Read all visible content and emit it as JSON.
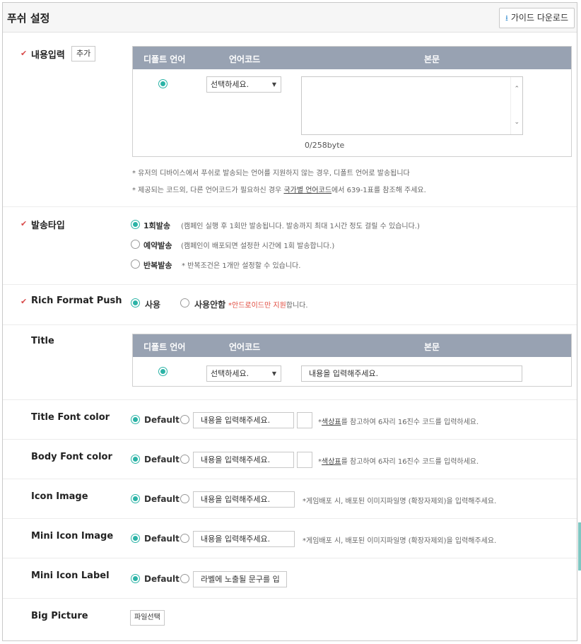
{
  "header": {
    "title": "푸쉬 설정",
    "guide_button": "가이드 다운로드"
  },
  "content_input": {
    "label": "내용입력",
    "add_button": "추가",
    "table_headers": [
      "디폴트 언어",
      "언어코드",
      "본문"
    ],
    "select_value": "선택하세요.",
    "byte_count": "0/258byte",
    "note1": "* 유저의 디바이스에서 푸쉬로 발송되는 언어를 지원하지 않는 경우, 디폴트 언어로 발송됩니다",
    "note2_prefix": "* 제공되는 코드외, 다른 언어코드가 필요하신 경우 ",
    "note2_link": "국가별 언어코드",
    "note2_suffix": "에서 639-1표를 참조해 주세요."
  },
  "send_type": {
    "label": "발송타입",
    "options": [
      {
        "label": "1회발송",
        "desc": "(캠페인 실행 후 1회만 발송됩니다. 발송까지 최대 1시간 정도 걸릴 수 있습니다.)",
        "selected": true
      },
      {
        "label": "예약발송",
        "desc": "(캠페인이 배포되면 설정한 시간에 1회 발송합니다.)",
        "selected": false
      },
      {
        "label": "반복발송",
        "desc": "* 반복조건은 1개만 설정할 수 있습니다.",
        "selected": false
      }
    ]
  },
  "rich_format": {
    "label": "Rich Format Push",
    "use": "사용",
    "not_use": "사용안함",
    "note_prefix": "*",
    "note_red": "안드로이드만 지원",
    "note_suffix": "합니다."
  },
  "title_row": {
    "label": "Title",
    "table_headers": [
      "디폴트 언어",
      "언어코드",
      "본문"
    ],
    "select_value": "선택하세요.",
    "input_value": "내용을 입력해주세요."
  },
  "rows": [
    {
      "label": "Title Font color",
      "default": "Default",
      "input": "내용을 입력해주세요.",
      "note_prefix": "*",
      "note_link": "색상표",
      "note_suffix": "를 참고하여 6자리 16진수 코드를 입력하세요."
    },
    {
      "label": "Body Font color",
      "default": "Default",
      "input": "내용을 입력해주세요.",
      "note_prefix": "*",
      "note_link": "색상표",
      "note_suffix": "를 참고하여 6자리 16진수 코드를 입력하세요."
    },
    {
      "label": "Icon Image",
      "default": "Default",
      "input": "내용을 입력해주세요.",
      "note": "*게임배포 시, 배포된 이미지파일명 (확장자제외)을 입력해주세요."
    },
    {
      "label": "Mini Icon Image",
      "default": "Default",
      "input": "내용을 입력해주세요.",
      "note": "*게임배포 시, 배포된 이미지파일명 (확장자제외)을 입력해주세요."
    },
    {
      "label": "Mini Icon Label",
      "default": "Default",
      "input": "라벨에 노출될 문구를 입"
    }
  ],
  "big_picture": {
    "label": "Big Picture",
    "file_button": "파일선택"
  },
  "colors": {
    "accent": "#2bb3a6",
    "table_header": "#98a2b2",
    "required": "#d94b4b",
    "warning": "#e0493c"
  }
}
